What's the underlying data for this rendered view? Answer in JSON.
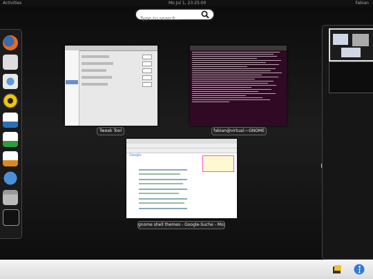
{
  "topbar": {
    "activities_label": "Activities",
    "clock": "Mo Jul 1, 23:25:00",
    "user": "Fabian"
  },
  "search": {
    "placeholder": "Type to search..."
  },
  "dash": {
    "apps": [
      "firefox-icon",
      "mail-icon",
      "settings-icon",
      "music-icon",
      "writer-icon",
      "calc-icon",
      "impress-icon",
      "help-icon",
      "files-icon",
      "terminal-icon"
    ]
  },
  "windows": [
    {
      "caption": "Tweak Tool"
    },
    {
      "caption": "fabian@virtual:~GNOME"
    },
    {
      "caption": "gnome shell themes - Google-Suche - Mozilla Firefox"
    }
  ],
  "firefox_page": {
    "logo": "Google"
  },
  "colors": {
    "accent": "#6a8fc8",
    "terminal_bg": "#300a24"
  }
}
